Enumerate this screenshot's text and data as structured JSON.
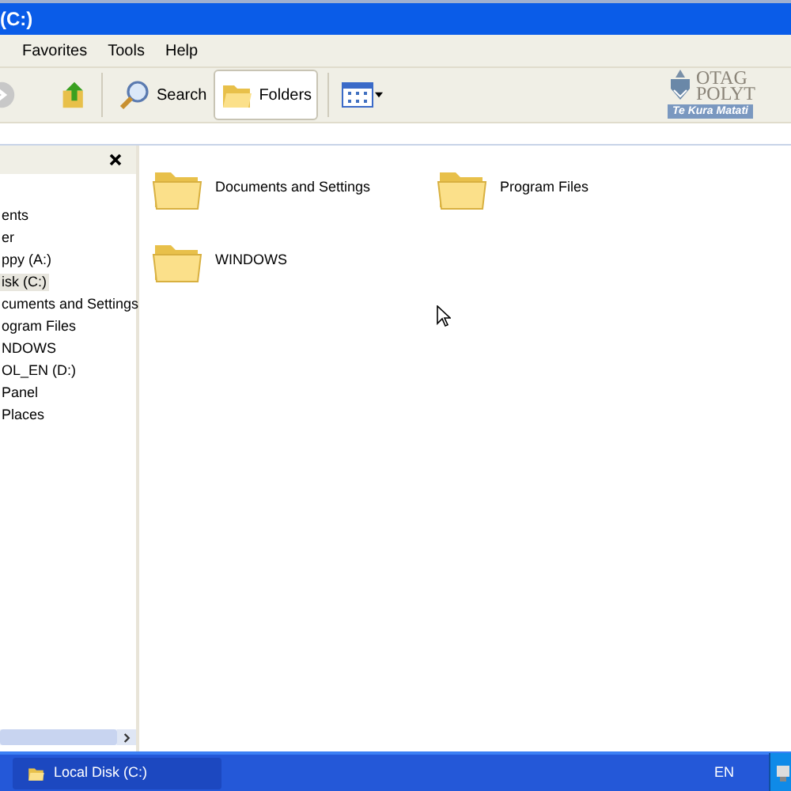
{
  "window": {
    "title": "(C:)"
  },
  "menu": [
    "Favorites",
    "Tools",
    "Help"
  ],
  "toolbar": [
    {
      "kind": "forward"
    },
    {
      "kind": "up"
    },
    {
      "kind": "search",
      "label": "Search",
      "selected": false
    },
    {
      "kind": "folders",
      "label": "Folders",
      "selected": true
    },
    {
      "kind": "views"
    }
  ],
  "logo": {
    "line_1": "OTAG",
    "line_2": "POLYT",
    "tagline": "Te Kura Matati"
  },
  "folders_pane": {
    "items": [
      {
        "label": "ents",
        "selected": false
      },
      {
        "label": "er",
        "selected": false
      },
      {
        "label": "ppy (A:)",
        "selected": false
      },
      {
        "label": "isk (C:)",
        "selected": true
      },
      {
        "label": "cuments and Settings",
        "selected": false
      },
      {
        "label": "ogram Files",
        "selected": false
      },
      {
        "label": "NDOWS",
        "selected": false
      },
      {
        "label": "OL_EN (D:)",
        "selected": false
      },
      {
        "label": "Panel",
        "selected": false
      },
      {
        "label": "Places",
        "selected": false
      }
    ]
  },
  "files": [
    {
      "name": "Documents and Settings"
    },
    {
      "name": "Program Files"
    },
    {
      "name": "WINDOWS"
    }
  ],
  "taskbar": {
    "window_button": "Local Disk (C:)",
    "language": "EN"
  }
}
